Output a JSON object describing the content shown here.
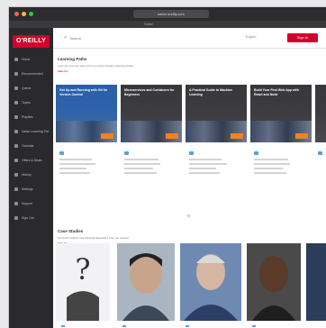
{
  "window": {
    "title_pill": "safari.oreilly.com"
  },
  "browser": {
    "tab_label": "Safari"
  },
  "sidebar": {
    "logo": "O'REILLY",
    "items": [
      {
        "label": "Home"
      },
      {
        "label": "Recommended"
      },
      {
        "label": "Queue"
      },
      {
        "label": "Topics"
      },
      {
        "label": "Playlists"
      },
      {
        "label": "Safari Learning Paths"
      },
      {
        "label": "Tutorials"
      },
      {
        "label": "Offers & Deals"
      },
      {
        "label": "History"
      },
      {
        "label": "Settings"
      },
      {
        "label": "Support"
      },
      {
        "label": "Sign Out"
      }
    ]
  },
  "topbar": {
    "search_placeholder": "Search",
    "language": "English",
    "signin_label": "Sign In"
  },
  "learning_paths": {
    "title": "Learning Paths",
    "subtitle": "Learn at your own pace with our expert-curated Learning Paths",
    "see_all": "SEE ALL",
    "cards": [
      {
        "title": "Get Up and Running with Git for Version Control"
      },
      {
        "title": "Microservices and Containers for Beginners"
      },
      {
        "title": "A Practical Guide to Machine Learning"
      },
      {
        "title": "Build Your First Web App with React and Node"
      }
    ]
  },
  "case_studies": {
    "title": "Case Studies",
    "subtitle": "Get fresh insights and practical takeaways from our experts",
    "see_all": "SEE ALL"
  },
  "colors": {
    "brand_red": "#d3002d",
    "sidebar_bg": "#2a2a2c",
    "card_blue": "#2a5fa8",
    "badge_orange": "#f58220",
    "meta_blue": "#5aa0d6"
  }
}
